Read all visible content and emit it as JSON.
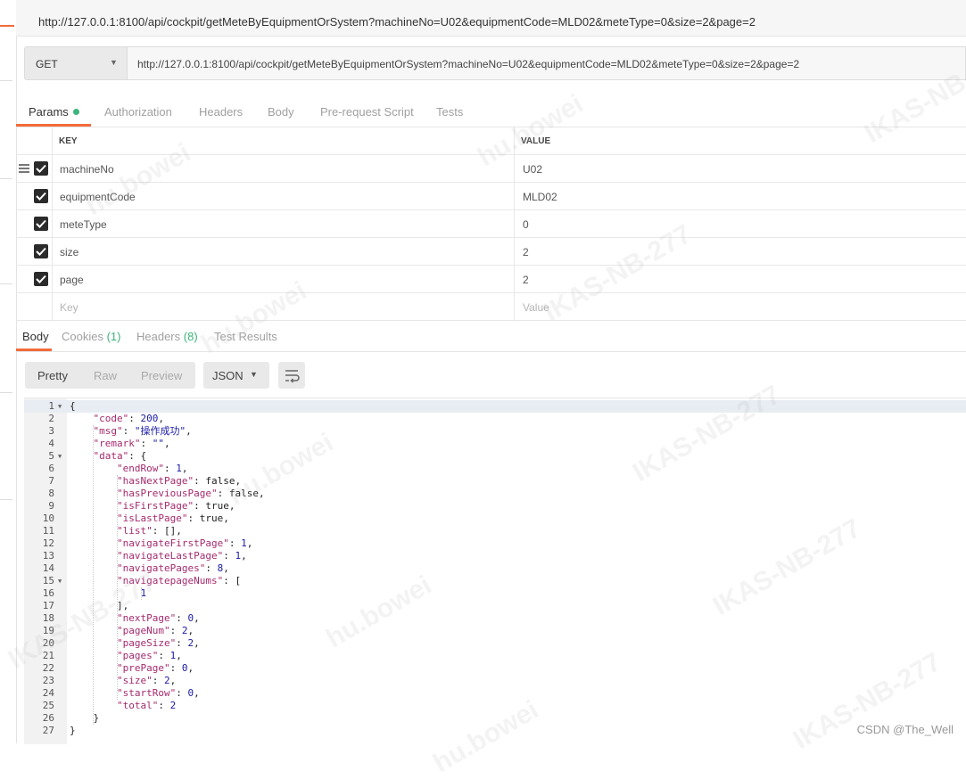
{
  "window": {
    "title_url": "http://127.0.0.1:8100/api/cockpit/getMeteByEquipmentOrSystem?machineNo=U02&equipmentCode=MLD02&meteType=0&size=2&page=2"
  },
  "request": {
    "method": "GET",
    "url": "http://127.0.0.1:8100/api/cockpit/getMeteByEquipmentOrSystem?machineNo=U02&equipmentCode=MLD02&meteType=0&size=2&page=2"
  },
  "request_tabs": [
    "Params",
    "Authorization",
    "Headers",
    "Body",
    "Pre-request Script",
    "Tests"
  ],
  "params": {
    "key_header": "KEY",
    "value_header": "VALUE",
    "rows": [
      {
        "key": "machineNo",
        "value": "U02"
      },
      {
        "key": "equipmentCode",
        "value": "MLD02"
      },
      {
        "key": "meteType",
        "value": "0"
      },
      {
        "key": "size",
        "value": "2"
      },
      {
        "key": "page",
        "value": "2"
      }
    ],
    "key_placeholder": "Key",
    "value_placeholder": "Value"
  },
  "response_tabs": {
    "body": "Body",
    "cookies": "Cookies",
    "cookies_count": "(1)",
    "headers": "Headers",
    "headers_count": "(8)",
    "test_results": "Test Results"
  },
  "view_modes": [
    "Pretty",
    "Raw",
    "Preview"
  ],
  "format": "JSON",
  "response_lines": [
    "{",
    "    \"code\": 200,",
    "    \"msg\": \"操作成功\",",
    "    \"remark\": \"\",",
    "    \"data\": {",
    "        \"endRow\": 1,",
    "        \"hasNextPage\": false,",
    "        \"hasPreviousPage\": false,",
    "        \"isFirstPage\": true,",
    "        \"isLastPage\": true,",
    "        \"list\": [],",
    "        \"navigateFirstPage\": 1,",
    "        \"navigateLastPage\": 1,",
    "        \"navigatePages\": 8,",
    "        \"navigatepageNums\": [",
    "            1",
    "        ],",
    "        \"nextPage\": 0,",
    "        \"pageNum\": 2,",
    "        \"pageSize\": 2,",
    "        \"pages\": 1,",
    "        \"prePage\": 0,",
    "        \"size\": 2,",
    "        \"startRow\": 0,",
    "        \"total\": 2",
    "    }",
    "}"
  ],
  "watermarks": [
    "hu.bowei",
    "IKAS-NB-277"
  ],
  "footer_watermark": "CSDN @The_Well"
}
